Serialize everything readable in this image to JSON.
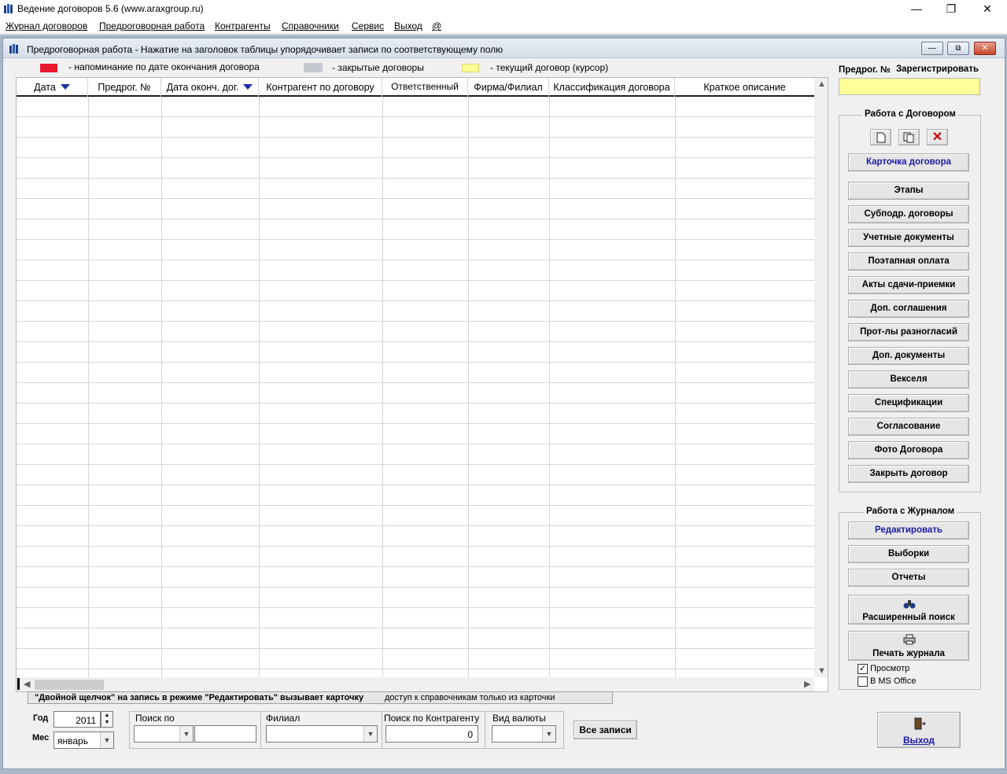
{
  "window": {
    "title": "Ведение договоров 5.6 (www.araxgroup.ru)",
    "minimize": "—",
    "maximize": "❐",
    "close": "✕"
  },
  "menu": {
    "items": [
      "Журнал договоров",
      "Предроговорная работа",
      "Контрагенты",
      "Справочники",
      "Сервис",
      "Выход",
      "@"
    ]
  },
  "child_window": {
    "title": "Предроговорная работа  -  Нажатие на заголовок таблицы упорядочивает записи по соответствующему полю",
    "buttons": [
      "—",
      "⧉",
      "✕"
    ]
  },
  "legend": [
    {
      "label": "- напоминание по дате окончания договора",
      "color": "#e8192c"
    },
    {
      "label": "- закрытые договоры",
      "color": "#c5c9cf"
    },
    {
      "label": "- текущий договор (курсор)",
      "color": "#ffff99"
    }
  ],
  "grid": {
    "columns": [
      "Дата",
      "Предрог. №",
      "Дата оконч. дог.",
      "Контрагент по договору",
      "Ответственный",
      "Фирма/Филиал",
      "Классификация договора",
      "Краткое описание"
    ],
    "rows": 28
  },
  "status": {
    "left": "\"Двойной щелчок\" на запись в режиме \"Редактировать\" вызывает карточку",
    "right": "доступ к справочникам только из карточки"
  },
  "filters": {
    "year_label": "Год",
    "year_value": "2011",
    "month_label": "Мес",
    "month_value": "январь",
    "search_by_label": "Поиск по",
    "branch_label": "Филиал",
    "counterparty_label": "Поиск по Контрагенту",
    "counterparty_value": "0",
    "currency_label": "Вид валюты",
    "all_records": "Все записи"
  },
  "right_panel": {
    "predog_label": "Предрог. №",
    "register": "Зарегистрировать",
    "predog_value": "",
    "contract_group_title": "Работа с Договором",
    "card_button": "Карточка договора",
    "buttons": [
      "Этапы",
      "Субподр. договоры",
      "Учетные документы",
      "Поэтапная оплата",
      "Акты сдачи-приемки",
      "Доп. соглашения",
      "Прот-лы разногласий",
      "Доп. документы",
      "Векселя",
      "Спецификации",
      "Согласование",
      "Фото Договора",
      "Закрыть договор"
    ],
    "journal_group_title": "Работа с Журналом",
    "edit_button": "Редактировать",
    "select_button": "Выборки",
    "reports_button": "Отчеты",
    "ext_search": "Расширенный поиск",
    "print_journal": "Печать журнала",
    "preview_label": "Просмотр",
    "preview_checked": true,
    "office_label": "В MS Office",
    "office_checked": false,
    "exit": "Выход"
  }
}
